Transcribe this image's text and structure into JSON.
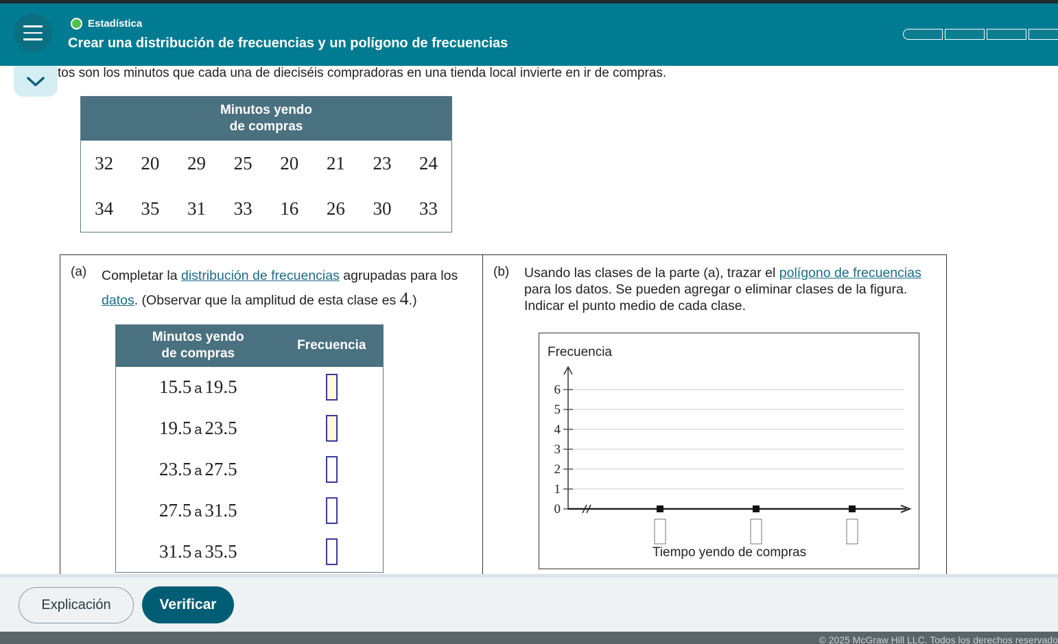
{
  "header": {
    "subject": "Estadística",
    "title": "Crear una distribución de frecuencias y un polígono de frecuencias",
    "progress_segments": 4,
    "subject_dot_color": "#4ec34e",
    "bg_color": "#007b91"
  },
  "intro_text": "tos son los minutos que cada una de dieciséis compradoras en una tienda local invierte en ir de compras.",
  "data_table": {
    "header": "Minutos yendo de compras",
    "rows": [
      [
        "32",
        "20",
        "29",
        "25",
        "20",
        "21",
        "23",
        "24"
      ],
      [
        "34",
        "35",
        "31",
        "33",
        "16",
        "26",
        "30",
        "33"
      ]
    ]
  },
  "part_a": {
    "label": "(a)",
    "text_1": "Completar la ",
    "link_1": "distribución de frecuencias",
    "text_2": " agrupadas para los ",
    "link_2": "datos",
    "text_3": ". (Observar que la amplitud de esta clase es ",
    "width_value": "4",
    "text_4": ".)",
    "table": {
      "col_header_1": "Minutos yendo de compras",
      "col_header_2": "Frecuencia",
      "connector": "a",
      "rows": [
        {
          "from": "15.5",
          "to": "19.5"
        },
        {
          "from": "19.5",
          "to": "23.5"
        },
        {
          "from": "23.5",
          "to": "27.5"
        },
        {
          "from": "27.5",
          "to": "31.5"
        },
        {
          "from": "31.5",
          "to": "35.5"
        }
      ]
    }
  },
  "part_b": {
    "label": "(b)",
    "text_1": "Usando las clases de la parte (a), trazar el ",
    "link_1": "polígono de frecuencias",
    "text_2": " para los datos. Se pueden agregar o eliminar clases de la figura. Indicar el punto medio de cada clase.",
    "graph": {
      "y_axis_label": "Frecuencia",
      "x_axis_label": "Tiempo yendo de compras",
      "y_ticks": [
        "0",
        "1",
        "2",
        "3",
        "4",
        "5",
        "6"
      ],
      "x_markers": 3
    }
  },
  "buttons": {
    "explanation": "Explicación",
    "verify": "Verificar"
  },
  "footer": {
    "copyright": "© 2025 McGraw Hill LLC. Todos los derechos reservado"
  }
}
